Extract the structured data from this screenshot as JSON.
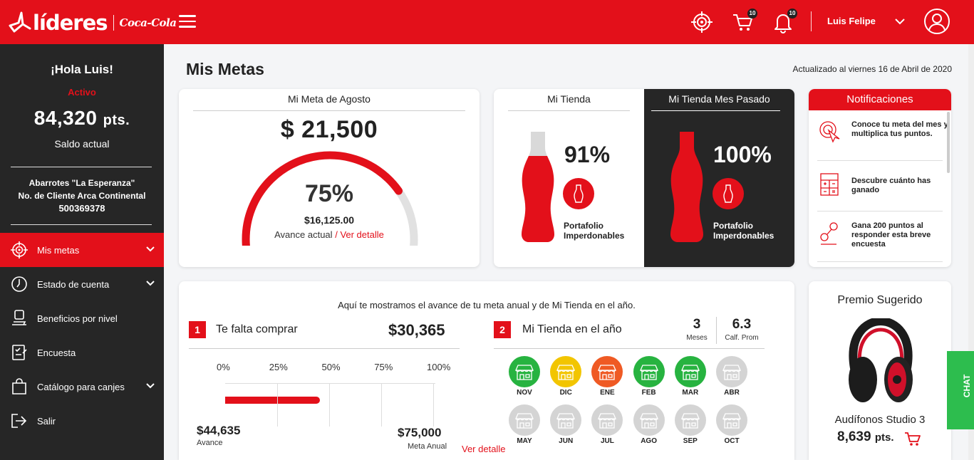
{
  "brand": {
    "logo_text": "líderes",
    "partner": "Coca-Cola"
  },
  "header": {
    "cart_count": "10",
    "notif_count": "10",
    "user_name": "Luis Felipe"
  },
  "sidebar": {
    "greeting": "¡Hola Luis!",
    "status": "Activo",
    "points_value": "84,320",
    "points_unit": "pts.",
    "balance_label": "Saldo actual",
    "store_name": "Abarrotes \"La Esperanza\"",
    "client_label": "No. de Cliente Arca Continental",
    "client_id": "500369378",
    "items": [
      {
        "label": "Mis metas",
        "icon": "target-icon"
      },
      {
        "label": "Estado de cuenta",
        "icon": "clock-icon"
      },
      {
        "label": "Beneficios por nivel",
        "icon": "hand-icon"
      },
      {
        "label": "Encuesta",
        "icon": "survey-icon"
      },
      {
        "label": "Catálogo para canjes",
        "icon": "bag-icon"
      },
      {
        "label": "Salir",
        "icon": "logout-icon"
      }
    ]
  },
  "main": {
    "title": "Mis Metas",
    "updated": "Actualizado al viernes 16 de Abril de 2020",
    "meta": {
      "title": "Mi Meta de Agosto",
      "amount": "$ 21,500",
      "percent": "75%",
      "progress": 0.75,
      "current_amount": "$16,125.00",
      "current_label": "Avance actual",
      "separator": "/",
      "detail_link": "Ver detalle"
    },
    "tienda": {
      "title": "Mi Tienda",
      "percent": "91%",
      "portfolio_line1": "Portafolio",
      "portfolio_line2": "Imperdonables"
    },
    "tienda_prev": {
      "title": "Mi Tienda Mes Pasado",
      "percent": "100%",
      "portfolio_line1": "Portafolio",
      "portfolio_line2": "Imperdonables"
    },
    "notifications": {
      "title": "Notificaciones",
      "items": [
        {
          "text": "Conoce tu meta del mes y multiplica tus puntos.",
          "icon": "target-click-icon"
        },
        {
          "text": "Descubre cuánto has ganado",
          "icon": "calculator-icon"
        },
        {
          "text": "Gana 200 puntos al responder esta breve encuesta",
          "icon": "survey-hand-icon"
        }
      ]
    },
    "annual": {
      "intro": "Aquí te mostramos el avance de tu meta anual y de Mi Tienda en el año.",
      "left": {
        "number": "1",
        "title": "Te falta comprar",
        "amount": "$30,365",
        "ticks": [
          "0%",
          "25%",
          "50%",
          "75%",
          "100%"
        ],
        "progress": 0.45,
        "avance_amount": "$44,635",
        "avance_label": "Avance",
        "meta_amount": "$75,000",
        "meta_label": "Meta Anual",
        "detail_link": "Ver detalle"
      },
      "right": {
        "number": "2",
        "title": "Mi Tienda en el año",
        "stat1_value": "3",
        "stat1_label": "Meses",
        "stat2_value": "6.3",
        "stat2_label": "Calf. Prom",
        "months": [
          {
            "label": "NOV",
            "color": "#27b340"
          },
          {
            "label": "DIC",
            "color": "#f2c500"
          },
          {
            "label": "ENE",
            "color": "#ef5a24"
          },
          {
            "label": "FEB",
            "color": "#27b340"
          },
          {
            "label": "MAR",
            "color": "#27b340"
          },
          {
            "label": "ABR",
            "color": "#d4d4d4"
          },
          {
            "label": "MAY",
            "color": "#d4d4d4"
          },
          {
            "label": "JUN",
            "color": "#d4d4d4"
          },
          {
            "label": "JUL",
            "color": "#d4d4d4"
          },
          {
            "label": "AGO",
            "color": "#d4d4d4"
          },
          {
            "label": "SEP",
            "color": "#d4d4d4"
          },
          {
            "label": "OCT",
            "color": "#d4d4d4"
          }
        ]
      }
    },
    "premio": {
      "title": "Premio Sugerido",
      "name": "Audífonos Studio 3",
      "points": "8,639",
      "points_unit": "pts."
    },
    "chat_label": "CHAT"
  },
  "colors": {
    "brand_red": "#e3101a",
    "dark": "#262626",
    "chat_green": "#2dbd4e"
  }
}
